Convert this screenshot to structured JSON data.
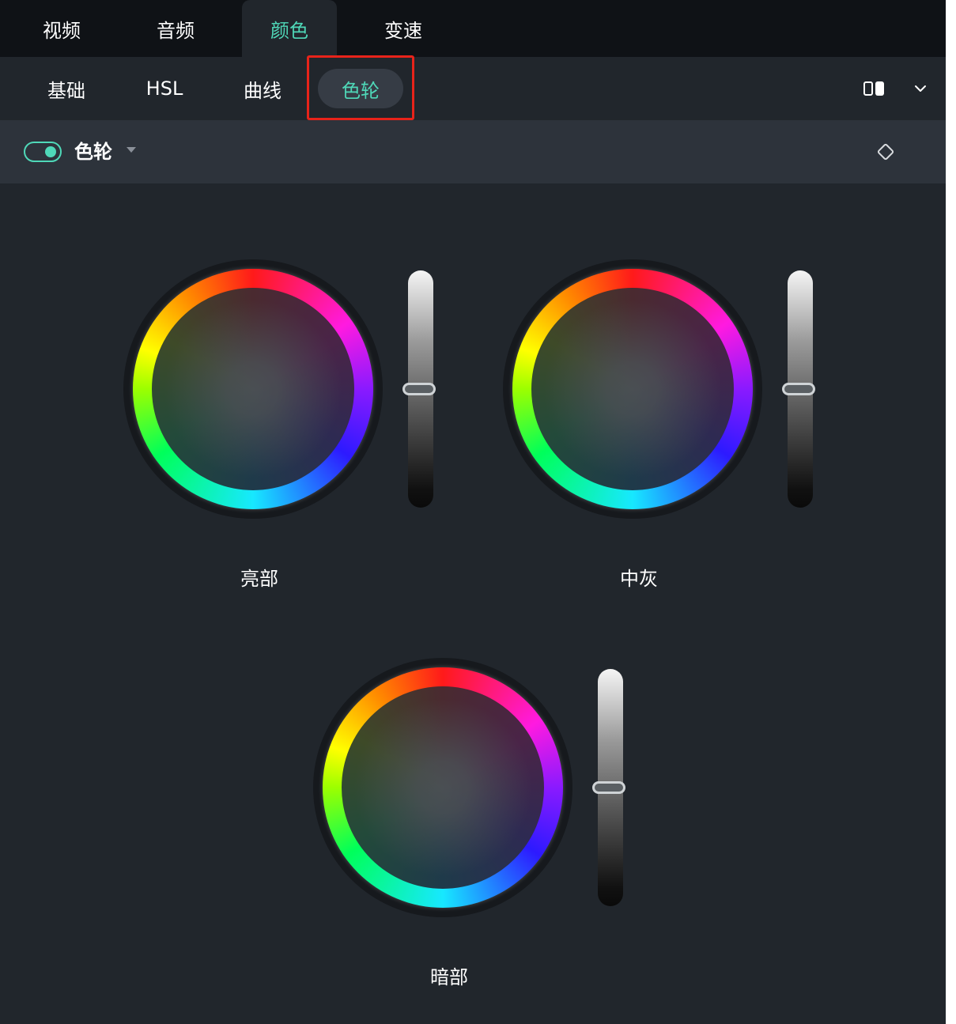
{
  "top_tabs": [
    {
      "label": "视频",
      "active": false
    },
    {
      "label": "音频",
      "active": false
    },
    {
      "label": "颜色",
      "active": true
    },
    {
      "label": "变速",
      "active": false
    }
  ],
  "sub_tabs": [
    {
      "label": "基础",
      "active": false
    },
    {
      "label": "HSL",
      "active": false
    },
    {
      "label": "曲线",
      "active": false
    },
    {
      "label": "色轮",
      "active": true
    }
  ],
  "toolbar_icons": [
    "compare-view-icon",
    "chevron-down-icon"
  ],
  "section": {
    "title": "色轮",
    "enabled": true,
    "icons": [
      "toggle-switch",
      "caret-down-icon",
      "keyframe-diamond-icon"
    ]
  },
  "wheels": [
    {
      "label": "亮部",
      "slider_level": 0.5
    },
    {
      "label": "中灰",
      "slider_level": 0.5
    },
    {
      "label": "暗部",
      "slider_level": 0.5
    }
  ],
  "colors": {
    "accent": "#4fd8b8",
    "panel_bg": "#21262c",
    "top_bar_bg": "#0f1216",
    "section_bg": "#2d333b",
    "highlight": "#e8231a"
  }
}
